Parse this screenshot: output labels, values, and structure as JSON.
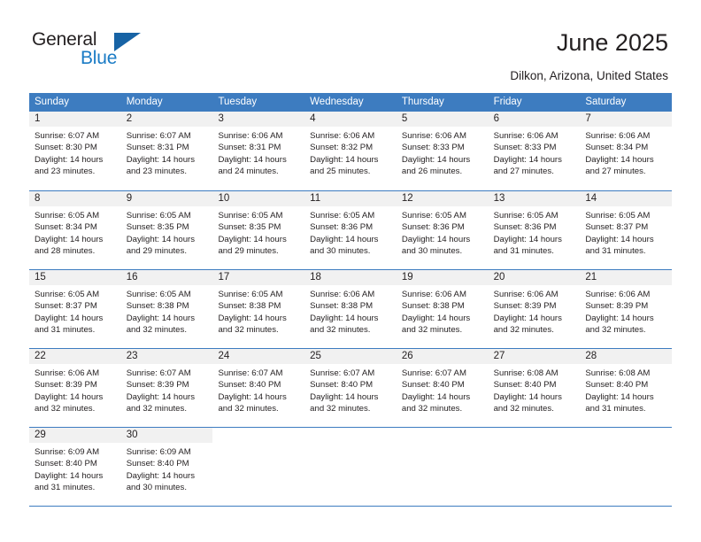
{
  "brand": {
    "name_part1": "General",
    "name_part2": "Blue",
    "triangle_icon": "triangle-icon",
    "color_dark": "#231f20",
    "color_blue": "#1a7bc5"
  },
  "header": {
    "title": "June 2025",
    "subtitle": "Dilkon, Arizona, United States"
  },
  "theme": {
    "header_blue": "#3d7cc0",
    "daynum_band": "#f1f1f1",
    "text": "#231f20"
  },
  "calendar": {
    "weekdays": [
      "Sunday",
      "Monday",
      "Tuesday",
      "Wednesday",
      "Thursday",
      "Friday",
      "Saturday"
    ],
    "weeks": [
      [
        {
          "day": "1",
          "lines": [
            "Sunrise: 6:07 AM",
            "Sunset: 8:30 PM",
            "Daylight: 14 hours",
            "and 23 minutes."
          ]
        },
        {
          "day": "2",
          "lines": [
            "Sunrise: 6:07 AM",
            "Sunset: 8:31 PM",
            "Daylight: 14 hours",
            "and 23 minutes."
          ]
        },
        {
          "day": "3",
          "lines": [
            "Sunrise: 6:06 AM",
            "Sunset: 8:31 PM",
            "Daylight: 14 hours",
            "and 24 minutes."
          ]
        },
        {
          "day": "4",
          "lines": [
            "Sunrise: 6:06 AM",
            "Sunset: 8:32 PM",
            "Daylight: 14 hours",
            "and 25 minutes."
          ]
        },
        {
          "day": "5",
          "lines": [
            "Sunrise: 6:06 AM",
            "Sunset: 8:33 PM",
            "Daylight: 14 hours",
            "and 26 minutes."
          ]
        },
        {
          "day": "6",
          "lines": [
            "Sunrise: 6:06 AM",
            "Sunset: 8:33 PM",
            "Daylight: 14 hours",
            "and 27 minutes."
          ]
        },
        {
          "day": "7",
          "lines": [
            "Sunrise: 6:06 AM",
            "Sunset: 8:34 PM",
            "Daylight: 14 hours",
            "and 27 minutes."
          ]
        }
      ],
      [
        {
          "day": "8",
          "lines": [
            "Sunrise: 6:05 AM",
            "Sunset: 8:34 PM",
            "Daylight: 14 hours",
            "and 28 minutes."
          ]
        },
        {
          "day": "9",
          "lines": [
            "Sunrise: 6:05 AM",
            "Sunset: 8:35 PM",
            "Daylight: 14 hours",
            "and 29 minutes."
          ]
        },
        {
          "day": "10",
          "lines": [
            "Sunrise: 6:05 AM",
            "Sunset: 8:35 PM",
            "Daylight: 14 hours",
            "and 29 minutes."
          ]
        },
        {
          "day": "11",
          "lines": [
            "Sunrise: 6:05 AM",
            "Sunset: 8:36 PM",
            "Daylight: 14 hours",
            "and 30 minutes."
          ]
        },
        {
          "day": "12",
          "lines": [
            "Sunrise: 6:05 AM",
            "Sunset: 8:36 PM",
            "Daylight: 14 hours",
            "and 30 minutes."
          ]
        },
        {
          "day": "13",
          "lines": [
            "Sunrise: 6:05 AM",
            "Sunset: 8:36 PM",
            "Daylight: 14 hours",
            "and 31 minutes."
          ]
        },
        {
          "day": "14",
          "lines": [
            "Sunrise: 6:05 AM",
            "Sunset: 8:37 PM",
            "Daylight: 14 hours",
            "and 31 minutes."
          ]
        }
      ],
      [
        {
          "day": "15",
          "lines": [
            "Sunrise: 6:05 AM",
            "Sunset: 8:37 PM",
            "Daylight: 14 hours",
            "and 31 minutes."
          ]
        },
        {
          "day": "16",
          "lines": [
            "Sunrise: 6:05 AM",
            "Sunset: 8:38 PM",
            "Daylight: 14 hours",
            "and 32 minutes."
          ]
        },
        {
          "day": "17",
          "lines": [
            "Sunrise: 6:05 AM",
            "Sunset: 8:38 PM",
            "Daylight: 14 hours",
            "and 32 minutes."
          ]
        },
        {
          "day": "18",
          "lines": [
            "Sunrise: 6:06 AM",
            "Sunset: 8:38 PM",
            "Daylight: 14 hours",
            "and 32 minutes."
          ]
        },
        {
          "day": "19",
          "lines": [
            "Sunrise: 6:06 AM",
            "Sunset: 8:38 PM",
            "Daylight: 14 hours",
            "and 32 minutes."
          ]
        },
        {
          "day": "20",
          "lines": [
            "Sunrise: 6:06 AM",
            "Sunset: 8:39 PM",
            "Daylight: 14 hours",
            "and 32 minutes."
          ]
        },
        {
          "day": "21",
          "lines": [
            "Sunrise: 6:06 AM",
            "Sunset: 8:39 PM",
            "Daylight: 14 hours",
            "and 32 minutes."
          ]
        }
      ],
      [
        {
          "day": "22",
          "lines": [
            "Sunrise: 6:06 AM",
            "Sunset: 8:39 PM",
            "Daylight: 14 hours",
            "and 32 minutes."
          ]
        },
        {
          "day": "23",
          "lines": [
            "Sunrise: 6:07 AM",
            "Sunset: 8:39 PM",
            "Daylight: 14 hours",
            "and 32 minutes."
          ]
        },
        {
          "day": "24",
          "lines": [
            "Sunrise: 6:07 AM",
            "Sunset: 8:40 PM",
            "Daylight: 14 hours",
            "and 32 minutes."
          ]
        },
        {
          "day": "25",
          "lines": [
            "Sunrise: 6:07 AM",
            "Sunset: 8:40 PM",
            "Daylight: 14 hours",
            "and 32 minutes."
          ]
        },
        {
          "day": "26",
          "lines": [
            "Sunrise: 6:07 AM",
            "Sunset: 8:40 PM",
            "Daylight: 14 hours",
            "and 32 minutes."
          ]
        },
        {
          "day": "27",
          "lines": [
            "Sunrise: 6:08 AM",
            "Sunset: 8:40 PM",
            "Daylight: 14 hours",
            "and 32 minutes."
          ]
        },
        {
          "day": "28",
          "lines": [
            "Sunrise: 6:08 AM",
            "Sunset: 8:40 PM",
            "Daylight: 14 hours",
            "and 31 minutes."
          ]
        }
      ],
      [
        {
          "day": "29",
          "lines": [
            "Sunrise: 6:09 AM",
            "Sunset: 8:40 PM",
            "Daylight: 14 hours",
            "and 31 minutes."
          ]
        },
        {
          "day": "30",
          "lines": [
            "Sunrise: 6:09 AM",
            "Sunset: 8:40 PM",
            "Daylight: 14 hours",
            "and 30 minutes."
          ]
        },
        {
          "day": "",
          "lines": []
        },
        {
          "day": "",
          "lines": []
        },
        {
          "day": "",
          "lines": []
        },
        {
          "day": "",
          "lines": []
        },
        {
          "day": "",
          "lines": []
        }
      ]
    ]
  }
}
